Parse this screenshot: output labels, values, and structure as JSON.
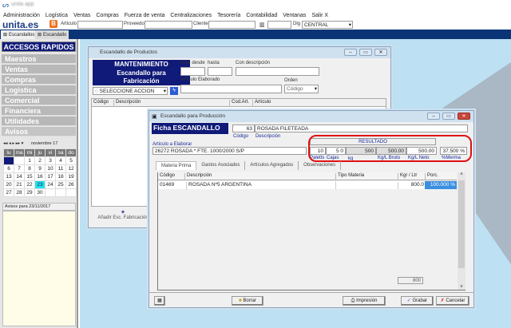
{
  "app": {
    "title_blurred": "unita app"
  },
  "menu": [
    "Administración",
    "Logística",
    "Ventas",
    "Compras",
    "Fuerza de venta",
    "Centralizaciones",
    "Tesorería",
    "Contabilidad",
    "Ventanas",
    "Salir X"
  ],
  "toolbar": {
    "logo": "unita.es",
    "articulo_label": "Articulo",
    "articulo_value": "",
    "proveedor_label": "Proveedor",
    "proveedor_value": "",
    "cliente_label": "Cliente",
    "cliente_value": "",
    "code_value": "",
    "dlg_label": "Dlg",
    "dlg_value": "CENTRAL"
  },
  "tabs": [
    "Escandallos",
    "Escandallo"
  ],
  "sidebar": {
    "title": "ACCESOS RAPIDOS",
    "items": [
      "Maestros",
      "Ventas",
      "Compras",
      "Logistica",
      "Comercial",
      "Financiera",
      "Utilidades"
    ],
    "avisos": "Avisos",
    "calendar": {
      "nav": "◂◂ ◂ ▸ ▸▸ ▾",
      "month": "noviembre 17",
      "days": [
        "lu",
        "ma",
        "mi",
        "ju",
        "vi",
        "sa",
        "do"
      ],
      "weeks": [
        [
          "",
          "",
          "1",
          "2",
          "3",
          "4",
          "5"
        ],
        [
          "6",
          "7",
          "8",
          "9",
          "10",
          "11",
          "12"
        ],
        [
          "13",
          "14",
          "15",
          "16",
          "17",
          "18",
          "19"
        ],
        [
          "20",
          "21",
          "22",
          "23",
          "24",
          "25",
          "26"
        ],
        [
          "27",
          "28",
          "29",
          "30",
          "",
          "",
          ""
        ]
      ],
      "selected": "23"
    },
    "avisos_para": "Avisos para 23/11/2017"
  },
  "win1": {
    "title": "Escandallo de Productos",
    "header_l1": "MANTENIMIENTO",
    "header_l2": "Escandallo para",
    "header_l3": "Fabricación",
    "cod_desde": "Cód. desde",
    "hasta": "hasta",
    "con_desc": "Con descripción",
    "art_elab": "Artículo Elaborado",
    "orden": "Orden",
    "orden_value": "Código",
    "accion": "SELECCIONE ACCION",
    "cols": [
      "Código",
      "Descripción",
      "Cod.Art.",
      "Artículo"
    ],
    "add": "Añadir Esc. Fabricación"
  },
  "win2": {
    "title": "Escandallo para Producción",
    "ficha": "Ficha ESCANDALLO",
    "codigo": "63",
    "descripcion": "ROSADA FILETEADA",
    "codigo_label": "Código",
    "descripcion_label": "Descripción",
    "art_label": "Articulo a Elaborar",
    "art_value": "26272 ROSADA * FTE. 1000/2000 S/P",
    "resultado": "RESULTADO",
    "paletts": "10",
    "cajas": "5 0",
    "kg": "500",
    "kg_bruto": "500.00",
    "kg_neto": "500.00",
    "merma": "37.500 %",
    "res_labels": [
      "Paletts",
      "Cajas",
      "kg",
      "Kg/L Bruto",
      "Kg/L Neto",
      "%Merma"
    ],
    "tabs": [
      "Materia Prima",
      "Gastos Asociados",
      "Artículos Agregados",
      "Observaciones"
    ],
    "cols": [
      "Código",
      "Descripción",
      "Tipo Materia",
      "Kgr / Ltr",
      "Porc."
    ],
    "rows": [
      {
        "codigo": "01469",
        "desc": "ROSADA Nº5 ARGENTINA",
        "tipo": "",
        "kg": "800.0",
        "porc": "100.000 %"
      }
    ],
    "total": "800",
    "buttons": {
      "borrar": "Borrar",
      "impresion": "Impresión",
      "grabar": "Grabar",
      "cancelar": "Cancelar"
    }
  },
  "colors": {
    "accent": "#101a78",
    "bg": "#bde0f3",
    "highlight": "#3a8fe0",
    "ring": "#e01010"
  }
}
